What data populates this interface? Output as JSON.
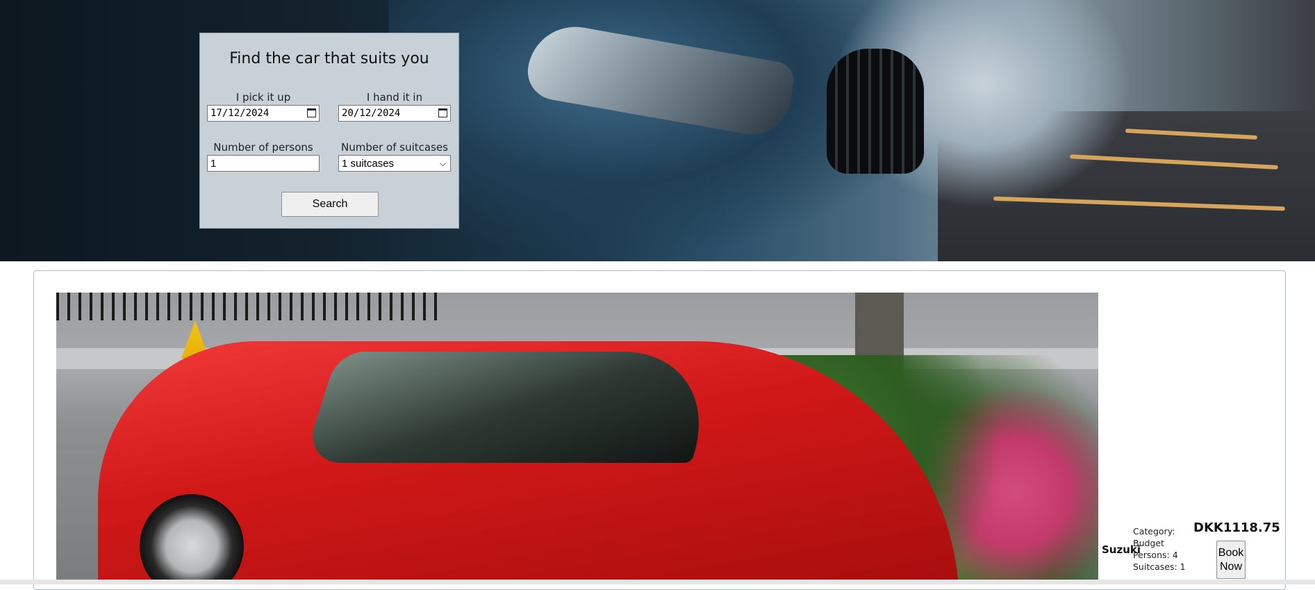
{
  "search": {
    "title": "Find the car that suits you",
    "pickup_label": "I pick it up",
    "pickup_value": "17/12/2024",
    "return_label": "I hand it in",
    "return_value": "20/12/2024",
    "persons_label": "Number of persons",
    "persons_value": "1",
    "suitcases_label": "Number of suitcases",
    "suitcases_value": "1 suitcases",
    "search_button": "Search"
  },
  "result": {
    "car_name": "Suzuki",
    "category": "Category:",
    "category_value": "Budget",
    "persons": "Persons: 4",
    "suitcases": "Suitcases: 1",
    "price": "DKK1118.75",
    "book_line1": "Book",
    "book_line2": "Now"
  },
  "icons": {
    "date_picker": "calendar-icon",
    "select": "chevron-down-icon"
  },
  "colors": {
    "search_panel_bg": "#c8d0d8",
    "card_border": "#a9bccb"
  }
}
